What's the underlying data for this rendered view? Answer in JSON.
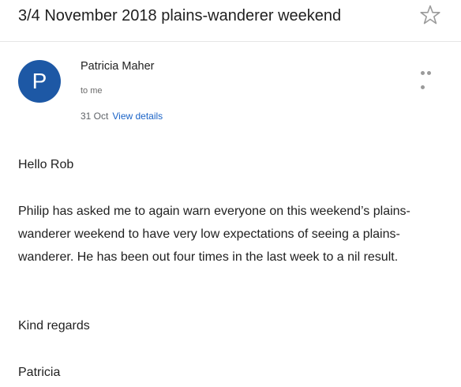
{
  "email": {
    "subject": "3/4 November 2018 plains-wanderer weekend",
    "sender": {
      "name": "Patricia Maher",
      "avatar_initial": "P",
      "avatar_color": "#1d58a5"
    },
    "recipient": "to me",
    "date": "31 Oct",
    "view_details_label": "View details",
    "body": {
      "greeting": "Hello Rob",
      "paragraph": "Philip has asked me to again warn everyone on this weekend’s plains-wanderer weekend to have very low expectations of seeing a plains-wanderer. He has been out four times in the last week to a nil result.",
      "closing": "Kind regards",
      "signature": "Patricia"
    }
  },
  "icons": {
    "star": "star-outline-icon",
    "more": "more-horizontal-icon"
  },
  "colors": {
    "link": "#1a63c7",
    "avatar": "#1d58a5"
  }
}
